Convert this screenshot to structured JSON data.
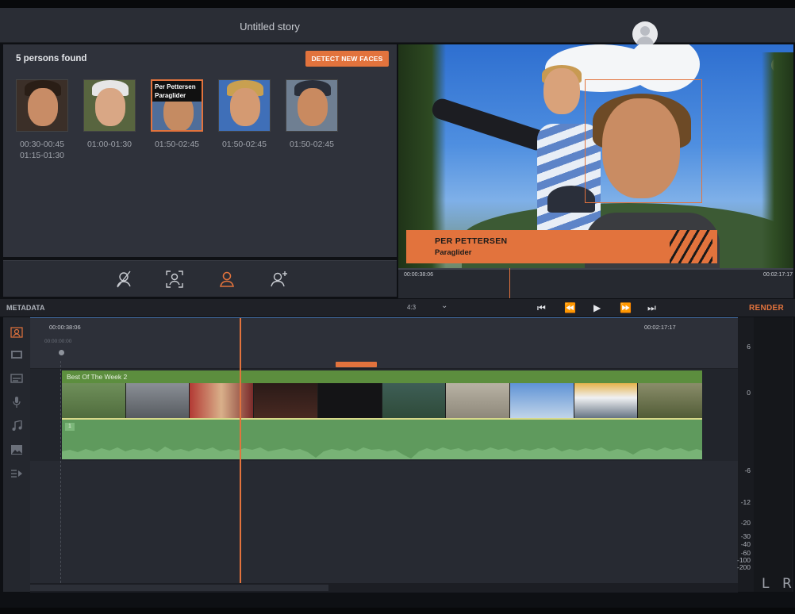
{
  "app": {
    "title": "Untitled story"
  },
  "faces": {
    "count_label": "5 persons found",
    "detect_button": "DETECT NEW FACES",
    "items": [
      {
        "times": [
          "00:30-00:45",
          "01:15-01:30"
        ]
      },
      {
        "times": [
          "01:00-01:30"
        ]
      },
      {
        "times": [
          "01:50-02:45"
        ],
        "tooltip_name": "Per Pettersen",
        "tooltip_role": "Paraglider"
      },
      {
        "times": [
          "01:50-02:45"
        ]
      },
      {
        "times": [
          "01:50-02:45"
        ]
      }
    ],
    "toolbar": {
      "icons": [
        "no-face-icon",
        "face-scan-icon",
        "person-icon",
        "add-person-icon"
      ],
      "active_icon": "person-icon"
    }
  },
  "preview": {
    "lower_third_name": "PER PETTERSEN",
    "lower_third_role": "Paraglider",
    "timecode_current": "00:00:38:06",
    "timecode_end": "00:02:17:17"
  },
  "transport": {
    "metadata_label": "METADATA",
    "aspect": "4:3",
    "buttons": [
      "skip-start-icon",
      "rewind-icon",
      "play-icon",
      "fast-forward-icon",
      "skip-end-icon"
    ],
    "glyphs": [
      "⏮",
      "⏪",
      "▶",
      "⏩",
      "⏭"
    ],
    "render_label": "RENDER"
  },
  "timeline": {
    "timecode_current": "00:00:38:06",
    "timecode_start": "00:00:00:00",
    "timecode_end": "00:02:17:17",
    "clip_title": "Best Of The Week 2",
    "audio_track_tag": "1",
    "tools": [
      "face-detect-icon",
      "film-icon",
      "caption-icon",
      "microphone-icon",
      "music-icon",
      "image-icon",
      "text-video-icon"
    ]
  },
  "meter": {
    "scale": [
      "6",
      "0",
      "-6",
      "-12",
      "-20",
      "-30",
      "-40",
      "-60",
      "-100",
      "-200"
    ],
    "left": "L",
    "right": "R"
  },
  "colors": {
    "accent": "#e2733d",
    "clip_green": "#5c8e3e",
    "panel": "#2f323b",
    "audio_green": "#5f9a5d"
  }
}
